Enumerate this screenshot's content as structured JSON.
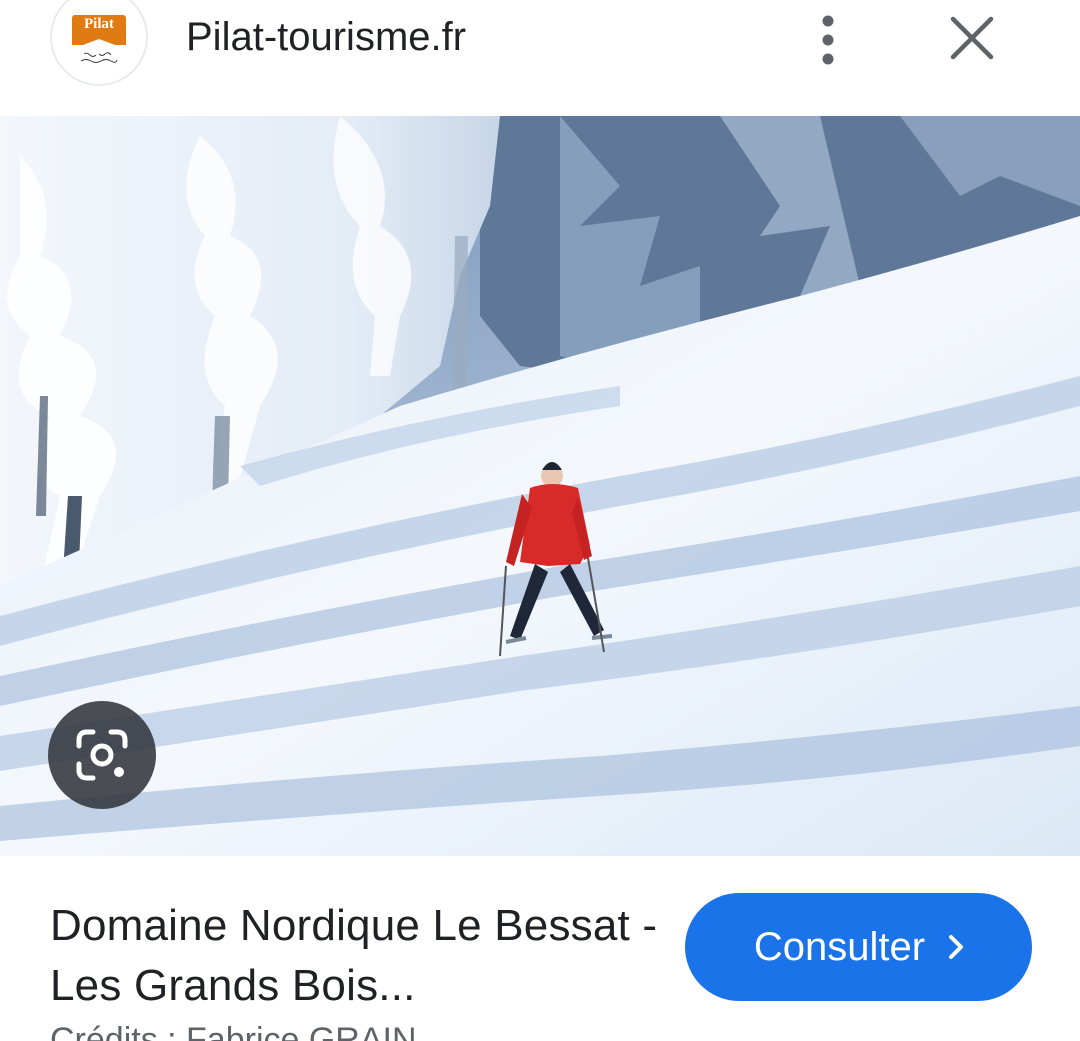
{
  "header": {
    "logo_text": "Pilat",
    "site_name": "Pilat-tourisme.fr",
    "more_icon": "more-vertical-icon",
    "close_icon": "close-icon"
  },
  "image": {
    "lens_icon": "google-lens-icon"
  },
  "result": {
    "title": "Domaine Nordique Le Bessat - Les Grands Bois...",
    "credit": "Crédits : Fabrice GRAIN",
    "consult_label": "Consulter",
    "consult_icon": "chevron-right-icon"
  },
  "colors": {
    "accent": "#1a73e8",
    "text": "#202124",
    "logo_orange": "#e07a12"
  }
}
